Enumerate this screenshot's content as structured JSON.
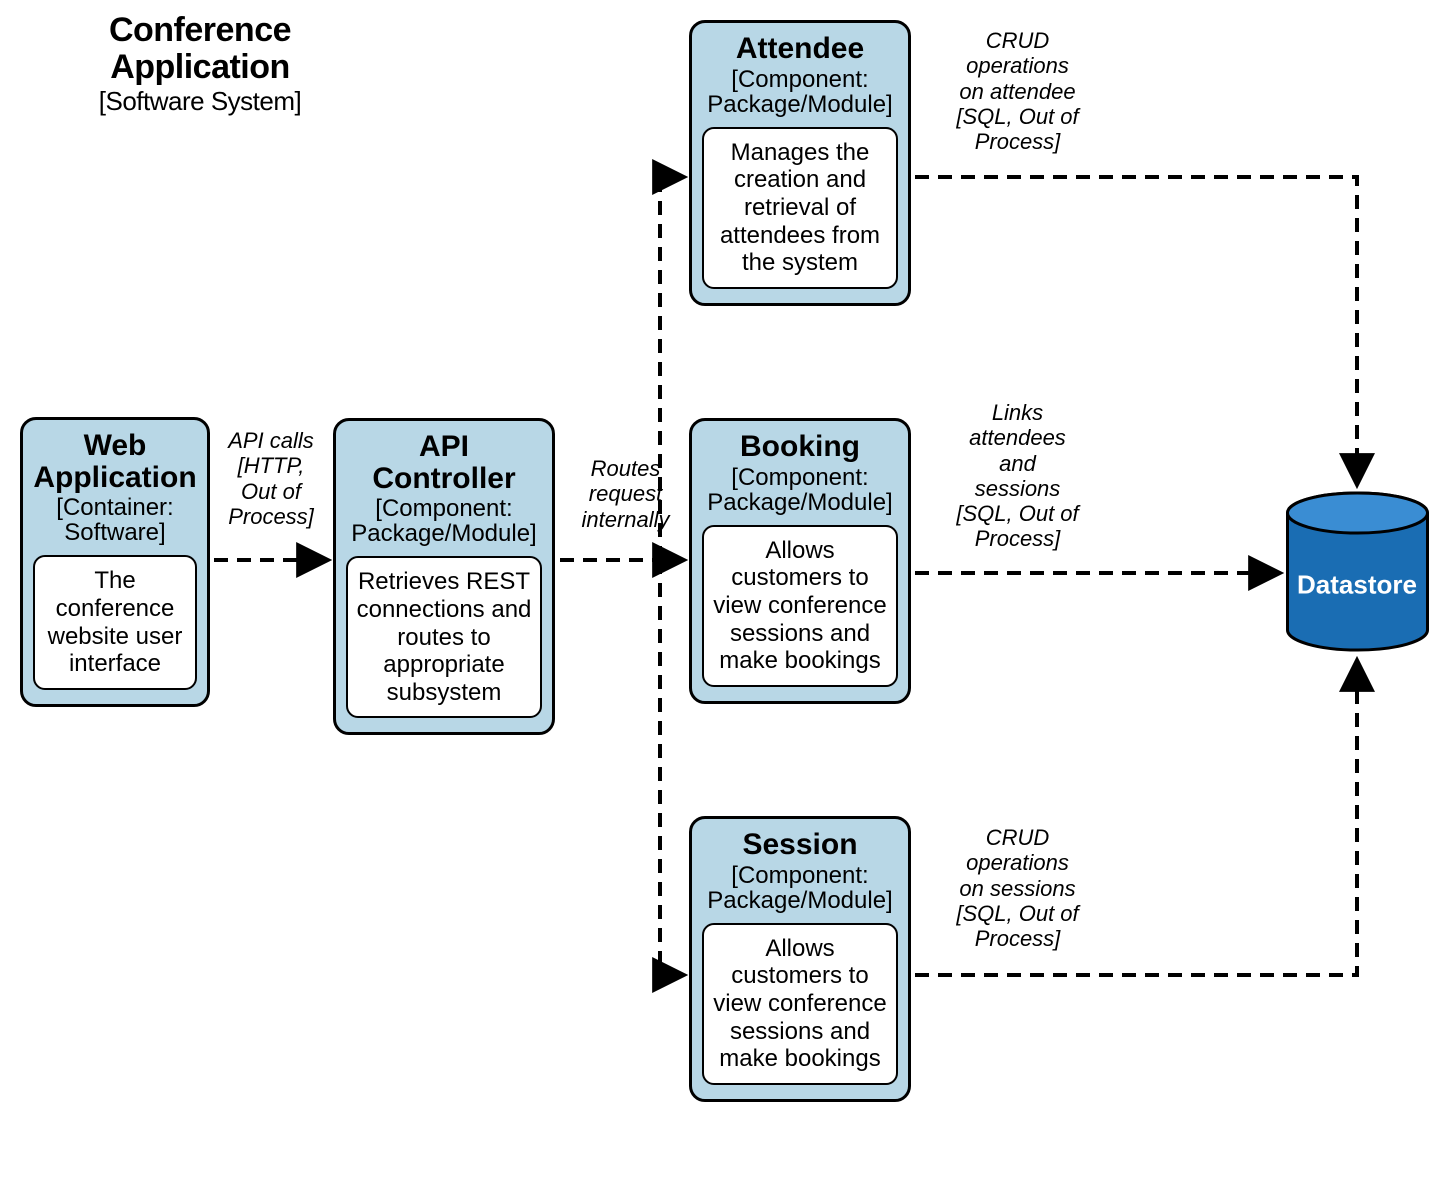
{
  "chart_data": {
    "type": "diagram",
    "title": "Conference Application",
    "subtitle": "[Software System]",
    "nodes": [
      {
        "id": "web",
        "name": "Web Application",
        "type": "[Container: Software]",
        "desc": "The conference website user interface"
      },
      {
        "id": "api",
        "name": "API Controller",
        "type": "[Component: Package/Module]",
        "desc": "Retrieves REST connections and routes to appropriate subsystem"
      },
      {
        "id": "attendee",
        "name": "Attendee",
        "type": "[Component: Package/Module]",
        "desc": "Manages the creation and retrieval of attendees from the system"
      },
      {
        "id": "booking",
        "name": "Booking",
        "type": "[Component: Package/Module]",
        "desc": "Allows customers to view conference sessions and make bookings"
      },
      {
        "id": "session",
        "name": "Session",
        "type": "[Component: Package/Module]",
        "desc": "Allows customers to view conference sessions and make bookings"
      },
      {
        "id": "datastore",
        "name": "Datastore",
        "type": "",
        "desc": ""
      }
    ],
    "edges": [
      {
        "from": "web",
        "to": "api",
        "label": "API calls [HTTP, Out of Process]"
      },
      {
        "from": "api",
        "to": "attendee",
        "label": "Routes request internally"
      },
      {
        "from": "api",
        "to": "booking",
        "label": "Routes request internally"
      },
      {
        "from": "api",
        "to": "session",
        "label": "Routes request internally"
      },
      {
        "from": "attendee",
        "to": "datastore",
        "label": "CRUD operations on attendee [SQL, Out of Process]"
      },
      {
        "from": "booking",
        "to": "datastore",
        "label": "Links attendees and sessions [SQL, Out of Process]"
      },
      {
        "from": "session",
        "to": "datastore",
        "label": "CRUD operations on sessions [SQL, Out of Process]"
      }
    ]
  },
  "title": {
    "main": "Conference Application",
    "sub": "[Software System]"
  },
  "nodes": {
    "web": {
      "name": "Web Application",
      "type": "[Container: Software]",
      "desc": "The conference website user interface"
    },
    "api": {
      "name": "API Controller",
      "type": "[Component: Package/Module]",
      "desc": "Retrieves REST connections and routes to appropriate subsystem"
    },
    "attendee": {
      "name": "Attendee",
      "type": "[Component: Package/Module]",
      "desc": "Manages the creation and retrieval of attendees from the system"
    },
    "booking": {
      "name": "Booking",
      "type": "[Component: Package/Module]",
      "desc": "Allows customers to view conference sessions and make bookings"
    },
    "session": {
      "name": "Session",
      "type": "[Component: Package/Module]",
      "desc": "Allows customers to view conference sessions and make bookings"
    },
    "datastore": {
      "name": "Datastore"
    }
  },
  "labels": {
    "web_api": "API calls\n[HTTP,\nOut of\nProcess]",
    "api_route": "Routes\nrequest\ninternally",
    "attendee_ds": "CRUD\noperations\non attendee\n[SQL, Out of\nProcess]",
    "booking_ds": "Links\nattendees\nand\nsessions\n[SQL, Out of\nProcess]",
    "session_ds": "CRUD\noperations\non sessions\n[SQL, Out of\nProcess]"
  }
}
